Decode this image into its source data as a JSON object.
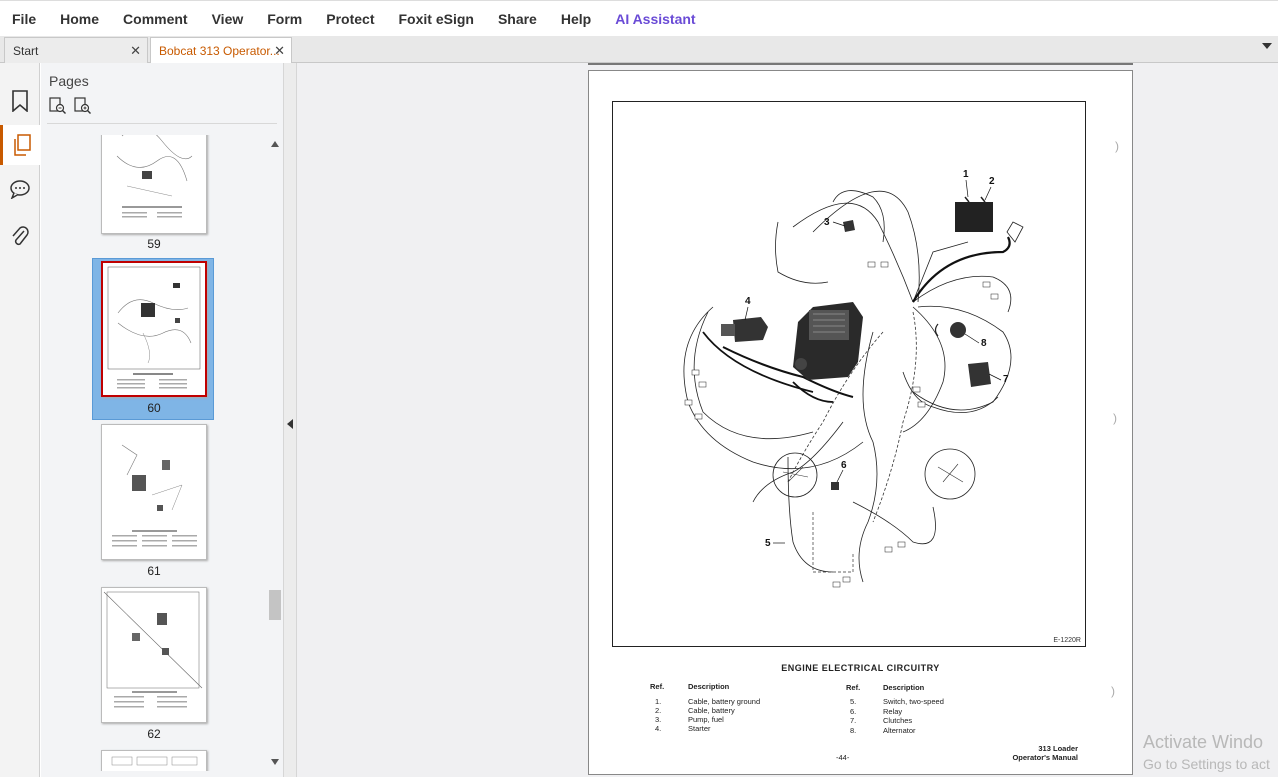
{
  "menu": [
    "File",
    "Home",
    "Comment",
    "View",
    "Form",
    "Protect",
    "Foxit eSign",
    "Share",
    "Help",
    "AI Assistant"
  ],
  "tabs": {
    "start_label": "Start",
    "doc_label": "Bobcat 313 Operator...",
    "close_glyph": "✕"
  },
  "panel": {
    "title": "Pages",
    "thumbnails": [
      {
        "label": "59"
      },
      {
        "label": "60",
        "selected": true
      },
      {
        "label": "61"
      },
      {
        "label": "62"
      }
    ]
  },
  "document": {
    "figure_id": "E-1220R",
    "caption": "ENGINE  ELECTRICAL  CIRCUITRY",
    "legend_headers": {
      "ref": "Ref.",
      "desc": "Description"
    },
    "legend_left": [
      {
        "ref": "1.",
        "desc": "Cable, battery ground"
      },
      {
        "ref": "2.",
        "desc": "Cable, battery"
      },
      {
        "ref": "3.",
        "desc": "Pump, fuel"
      },
      {
        "ref": "4.",
        "desc": "Starter"
      }
    ],
    "legend_right": [
      {
        "ref": "5.",
        "desc": "Switch, two-speed"
      },
      {
        "ref": "6.",
        "desc": "Relay"
      },
      {
        "ref": "7.",
        "desc": "Clutches"
      },
      {
        "ref": "8.",
        "desc": "Alternator"
      }
    ],
    "page_number": "-44-",
    "footer_line1": "313 Loader",
    "footer_line2": "Operator's Manual",
    "callouts": [
      "1",
      "2",
      "3",
      "4",
      "5",
      "6",
      "7",
      "8"
    ]
  },
  "watermark": {
    "line1": "Activate Windo",
    "line2": "Go to Settings to act"
  },
  "colors": {
    "accent": "#c85a00",
    "ai_purple": "#6a4bd6",
    "selection": "#7fb5e6",
    "selected_thumb_border": "#c00000"
  }
}
